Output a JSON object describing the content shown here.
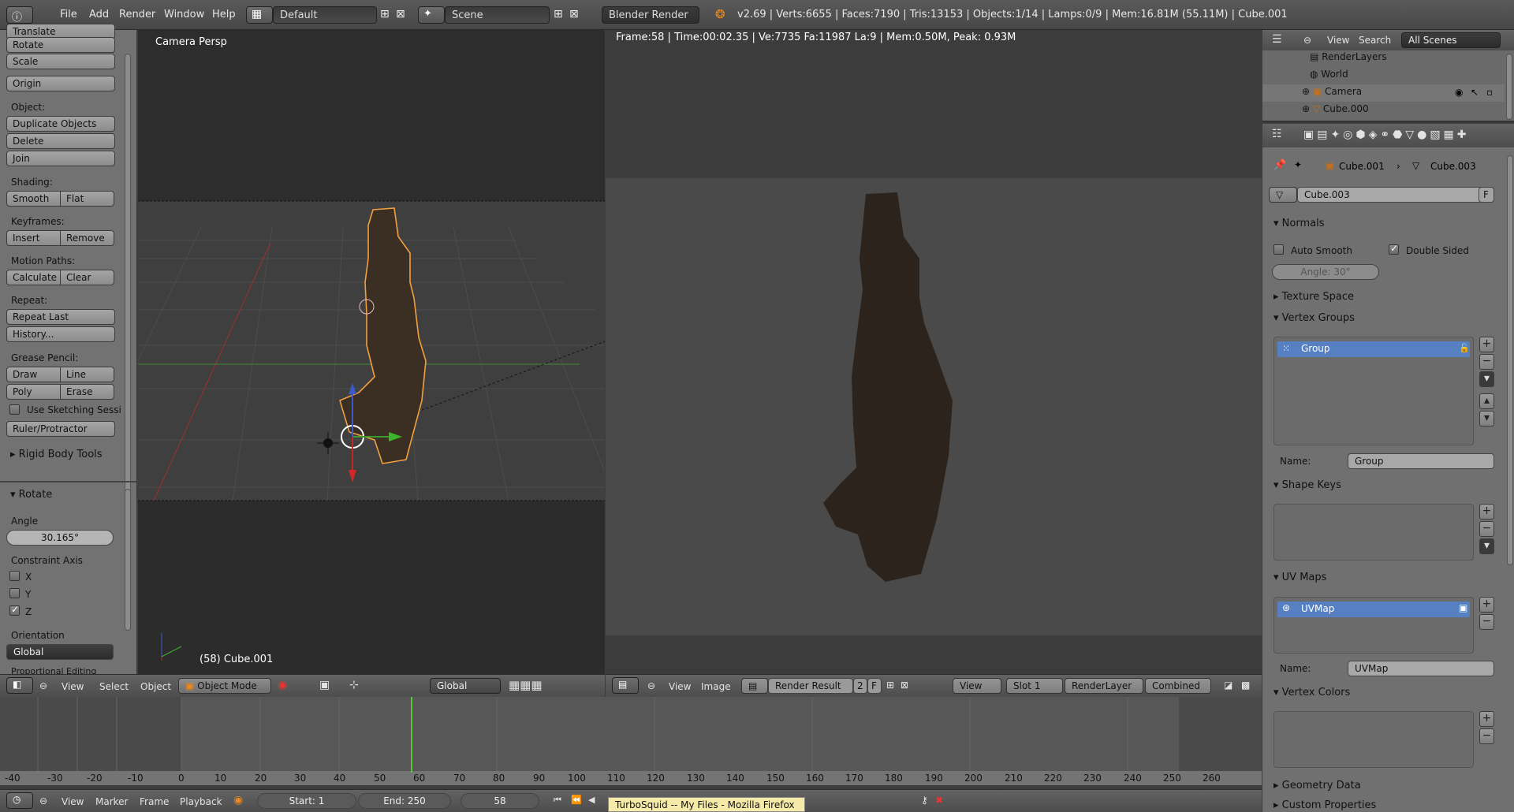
{
  "topbar": {
    "menus": [
      "File",
      "Add",
      "Render",
      "Window",
      "Help"
    ],
    "screen_layout": "Default",
    "scene": "Scene",
    "engine": "Blender Render",
    "stats": "v2.69 | Verts:6655 | Faces:7190 | Tris:13153 | Objects:1/14 | Lamps:0/9 | Mem:16.81M (55.11M) | Cube.001"
  },
  "toolshelf": {
    "translate": "Translate",
    "rotate": "Rotate",
    "scale": "Scale",
    "origin": "Origin",
    "object_label": "Object:",
    "duplicate": "Duplicate Objects",
    "delete": "Delete",
    "join": "Join",
    "shading_label": "Shading:",
    "smooth": "Smooth",
    "flat": "Flat",
    "keyframes_label": "Keyframes:",
    "insert": "Insert",
    "remove": "Remove",
    "motion_label": "Motion Paths:",
    "calculate": "Calculate",
    "clear": "Clear",
    "repeat_label": "Repeat:",
    "repeat_last": "Repeat Last",
    "history": "History...",
    "grease_label": "Grease Pencil:",
    "draw": "Draw",
    "line": "Line",
    "poly": "Poly",
    "erase": "Erase",
    "use_sketching": "Use Sketching Sessi",
    "ruler": "Ruler/Protractor",
    "rigid_body": "Rigid Body Tools"
  },
  "operator": {
    "title": "Rotate",
    "angle_label": "Angle",
    "angle_value": "30.165°",
    "constraint_label": "Constraint Axis",
    "x": "X",
    "y": "Y",
    "z": "Z",
    "x_checked": false,
    "y_checked": false,
    "z_checked": true,
    "orientation_label": "Orientation",
    "orientation_value": "Global",
    "proportional": "Proportional Editing"
  },
  "view3d": {
    "title": "Camera Persp",
    "object_info": "(58) Cube.001",
    "header": {
      "view": "View",
      "select": "Select",
      "object": "Object",
      "mode": "Object Mode",
      "orientation": "Global"
    }
  },
  "render": {
    "info": "Frame:58 | Time:00:02.35 | Ve:7735 Fa:11987 La:9 | Mem:0.50M, Peak: 0.93M",
    "header": {
      "view": "View",
      "image": "Image",
      "image_name": "Render Result",
      "users": "2",
      "fake": "F",
      "view_menu": "View",
      "slot": "Slot 1",
      "layer": "RenderLayer",
      "pass": "Combined"
    }
  },
  "outliner": {
    "view": "View",
    "search": "Search",
    "filter": "All Scenes",
    "items": [
      "RenderLayers",
      "World",
      "Camera",
      "Cube.000"
    ]
  },
  "properties": {
    "breadcrumb_obj": "Cube.001",
    "breadcrumb_mesh": "Cube.003",
    "mesh_name": "Cube.003",
    "fake_user": "F",
    "normals": "Normals",
    "auto_smooth": "Auto Smooth",
    "double_sided": "Double Sided",
    "angle": "Angle: 30°",
    "texture_space": "Texture Space",
    "vertex_groups": "Vertex Groups",
    "group_item": "Group",
    "name_label": "Name:",
    "group_name": "Group",
    "shape_keys": "Shape Keys",
    "uv_maps": "UV Maps",
    "uv_item": "UVMap",
    "uv_name": "UVMap",
    "vertex_colors": "Vertex Colors",
    "geometry_data": "Geometry Data",
    "custom_props": "Custom Properties"
  },
  "timeline": {
    "ticks": [
      "-40",
      "-30",
      "-20",
      "-10",
      "0",
      "10",
      "20",
      "30",
      "40",
      "50",
      "60",
      "70",
      "80",
      "90",
      "100",
      "110",
      "120",
      "130",
      "140",
      "150",
      "160",
      "170",
      "180",
      "190",
      "200",
      "210",
      "220",
      "230",
      "240",
      "250",
      "260"
    ],
    "current_frame": 58,
    "header": {
      "view": "View",
      "marker": "Marker",
      "frame": "Frame",
      "playback": "Playback",
      "start": "Start: 1",
      "end": "End: 250",
      "current": "58"
    }
  },
  "taskbar_tooltip": "TurboSquid -- My Files - Mozilla Firefox"
}
